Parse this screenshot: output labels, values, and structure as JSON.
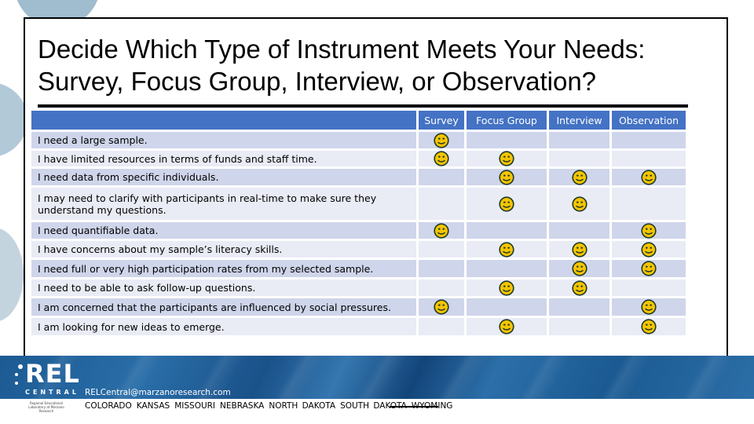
{
  "slide": {
    "title_line1": "Decide Which Type of Instrument Meets Your Needs:",
    "title_line2": "Survey, Focus Group, Interview, or Observation?"
  },
  "table": {
    "columns": [
      "",
      "Survey",
      "Focus Group",
      "Interview",
      "Observation"
    ],
    "mark_icon": "smiley-face-icon",
    "mark_color": "#f5c400",
    "header_color": "#4472c4",
    "rows": [
      {
        "label": "I need a large sample.",
        "survey": true,
        "focus_group": false,
        "interview": false,
        "observation": false
      },
      {
        "label": "I have limited resources in terms of funds and staff time.",
        "survey": true,
        "focus_group": true,
        "interview": false,
        "observation": false
      },
      {
        "label": "I need data from specific individuals.",
        "survey": false,
        "focus_group": true,
        "interview": true,
        "observation": true
      },
      {
        "label": "I may need to clarify with participants in real-time to make sure they understand my questions.",
        "survey": false,
        "focus_group": true,
        "interview": true,
        "observation": false
      },
      {
        "label": "I need quantifiable data.",
        "survey": true,
        "focus_group": false,
        "interview": false,
        "observation": true
      },
      {
        "label": "I have concerns about my sample’s literacy skills.",
        "survey": false,
        "focus_group": true,
        "interview": true,
        "observation": true
      },
      {
        "label": "I need full or very high participation rates from my selected sample.",
        "survey": false,
        "focus_group": false,
        "interview": true,
        "observation": true
      },
      {
        "label": "I need to be able to ask follow-up questions.",
        "survey": false,
        "focus_group": true,
        "interview": true,
        "observation": false
      },
      {
        "label": "I am concerned that the participants are influenced by social pressures.",
        "survey": true,
        "focus_group": false,
        "interview": false,
        "observation": true
      },
      {
        "label": "I am looking for new ideas to emerge.",
        "survey": false,
        "focus_group": true,
        "interview": false,
        "observation": true
      }
    ]
  },
  "footer": {
    "logo_text": "REL",
    "logo_subtext": "CENTRAL",
    "logo_tagline": "Regional Educational Laboratory at Marzano Research",
    "email": "RELCentral@marzanoresearch.com",
    "states": [
      "COLORADO",
      "KANSAS",
      "MISSOURI",
      "NEBRASKA",
      "NORTH DAKOTA",
      "SOUTH DAKOTA",
      "WYOMING"
    ]
  }
}
